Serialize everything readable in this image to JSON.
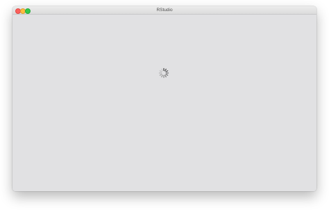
{
  "window": {
    "title": "RStudio"
  },
  "status": {
    "loading": true,
    "indicator": "spinner-icon"
  },
  "colors": {
    "content_background": "#e1e1e3",
    "close": "#fc605c",
    "minimize": "#fdbc40",
    "maximize": "#34c84a",
    "spinner": "#4a4a4a"
  }
}
